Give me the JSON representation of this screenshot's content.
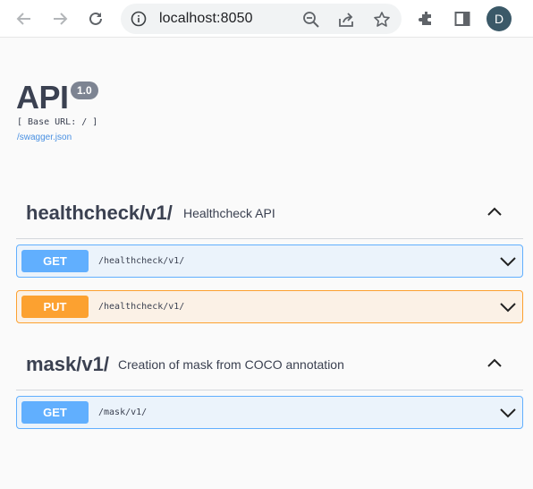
{
  "browser": {
    "url": "localhost:8050",
    "avatar_initial": "D",
    "icons": [
      "back-icon",
      "forward-icon",
      "reload-icon",
      "info-icon",
      "zoom-out-icon",
      "share-icon",
      "star-icon",
      "extensions-icon",
      "side-panel-icon",
      "more-icon"
    ]
  },
  "info": {
    "title": "API",
    "version": "1.0",
    "base_url": "[ Base URL: / ]",
    "spec_link": "/swagger.json"
  },
  "tags": [
    {
      "name": "healthcheck/v1/",
      "description": "Healthcheck API",
      "operations": [
        {
          "method": "GET",
          "path": "/healthcheck/v1/"
        },
        {
          "method": "PUT",
          "path": "/healthcheck/v1/"
        }
      ]
    },
    {
      "name": "mask/v1/",
      "description": "Creation of mask from COCO annotation",
      "operations": [
        {
          "method": "GET",
          "path": "/mask/v1/"
        }
      ]
    }
  ],
  "colors": {
    "get": "#61affe",
    "put": "#fca130",
    "link": "#4990e2",
    "text": "#3b4151"
  }
}
